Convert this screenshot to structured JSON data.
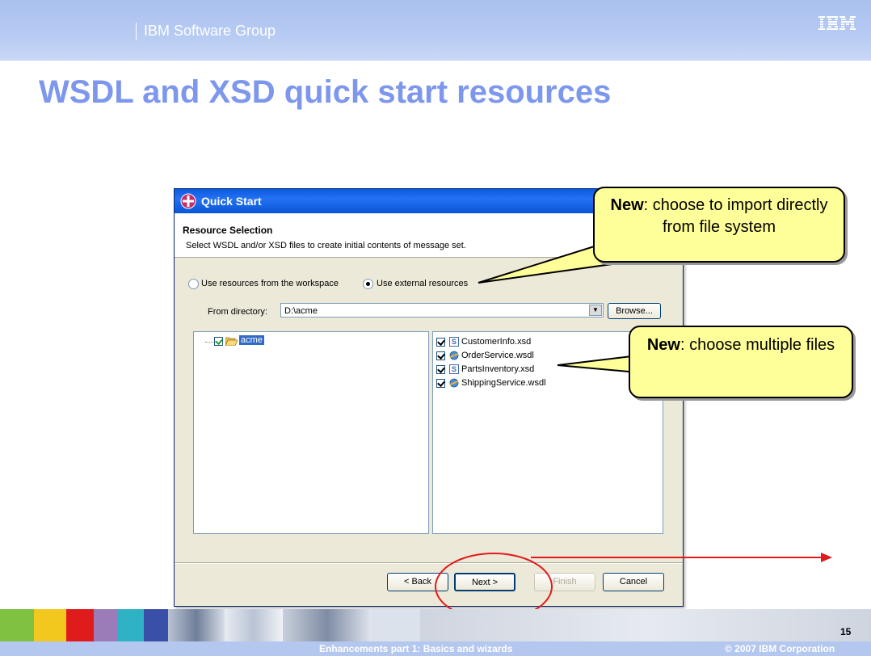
{
  "header": {
    "group": "IBM Software Group",
    "logo_text": "IBM"
  },
  "slide": {
    "title": "WSDL and XSD quick start resources"
  },
  "dialog": {
    "title": "Quick Start",
    "section_title": "Resource Selection",
    "description": "Select WSDL and/or XSD files to create initial contents of message set.",
    "radio_workspace": "Use resources from the workspace",
    "radio_external": "Use external resources",
    "selected_radio": "external",
    "from_directory_label": "From directory:",
    "from_directory_value": "D:\\acme",
    "browse_label": "Browse...",
    "tree": [
      {
        "label": "acme",
        "checked": true
      }
    ],
    "files": [
      {
        "name": "CustomerInfo.xsd",
        "type": "xsd-icon",
        "checked": true
      },
      {
        "name": "OrderService.wsdl",
        "type": "wsdl-icon",
        "checked": true
      },
      {
        "name": "PartsInventory.xsd",
        "type": "xsd-icon",
        "checked": true
      },
      {
        "name": "ShippingService.wsdl",
        "type": "wsdl-icon",
        "checked": true
      }
    ],
    "buttons": {
      "back": "< Back",
      "next": "Next >",
      "finish": "Finish",
      "cancel": "Cancel"
    }
  },
  "callouts": {
    "import": {
      "bold": "New",
      "text": ": choose to import directly from file system"
    },
    "multiple": {
      "bold": "New",
      "text": ": choose multiple files"
    }
  },
  "footer": {
    "page_number": "15",
    "center": "Enhancements part 1:  Basics and wizards",
    "right": "© 2007 IBM Corporation"
  },
  "colors": {
    "title_blue": "#7d97ec",
    "callout_fill": "#ffff99",
    "annotation_red": "#e01b1b"
  }
}
